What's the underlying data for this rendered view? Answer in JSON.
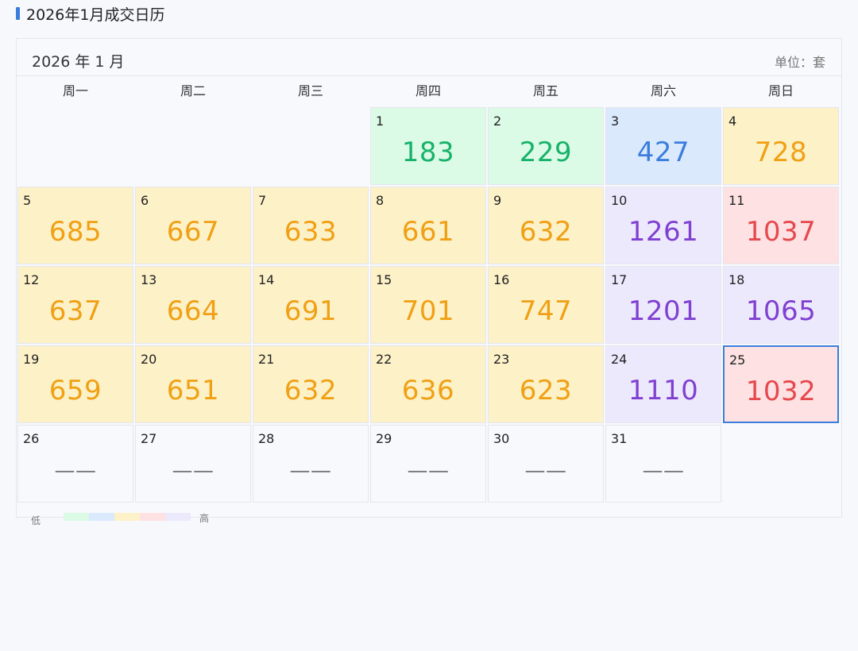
{
  "page_title": "2026年1月成交日历",
  "calendar": {
    "month_label": "2026 年 1 月",
    "unit_label": "单位：套",
    "weekdays": [
      "周一",
      "周二",
      "周三",
      "周四",
      "周五",
      "周六",
      "周日"
    ],
    "first_weekday_index": 3,
    "selected_day": 25,
    "empty_value_text": "——",
    "days": [
      {
        "day": "1",
        "value": "183",
        "level": 0
      },
      {
        "day": "2",
        "value": "229",
        "level": 0
      },
      {
        "day": "3",
        "value": "427",
        "level": 1
      },
      {
        "day": "4",
        "value": "728",
        "level": 2
      },
      {
        "day": "5",
        "value": "685",
        "level": 2
      },
      {
        "day": "6",
        "value": "667",
        "level": 2
      },
      {
        "day": "7",
        "value": "633",
        "level": 2
      },
      {
        "day": "8",
        "value": "661",
        "level": 2
      },
      {
        "day": "9",
        "value": "632",
        "level": 2
      },
      {
        "day": "10",
        "value": "1261",
        "level": 4
      },
      {
        "day": "11",
        "value": "1037",
        "level": 3
      },
      {
        "day": "12",
        "value": "637",
        "level": 2
      },
      {
        "day": "13",
        "value": "664",
        "level": 2
      },
      {
        "day": "14",
        "value": "691",
        "level": 2
      },
      {
        "day": "15",
        "value": "701",
        "level": 2
      },
      {
        "day": "16",
        "value": "747",
        "level": 2
      },
      {
        "day": "17",
        "value": "1201",
        "level": 4
      },
      {
        "day": "18",
        "value": "1065",
        "level": 4
      },
      {
        "day": "19",
        "value": "659",
        "level": 2
      },
      {
        "day": "20",
        "value": "651",
        "level": 2
      },
      {
        "day": "21",
        "value": "632",
        "level": 2
      },
      {
        "day": "22",
        "value": "636",
        "level": 2
      },
      {
        "day": "23",
        "value": "623",
        "level": 2
      },
      {
        "day": "24",
        "value": "1110",
        "level": 4
      },
      {
        "day": "25",
        "value": "1032",
        "level": 3
      },
      {
        "day": "26",
        "value": "",
        "level": -1
      },
      {
        "day": "27",
        "value": "",
        "level": -1
      },
      {
        "day": "28",
        "value": "",
        "level": -1
      },
      {
        "day": "29",
        "value": "",
        "level": -1
      },
      {
        "day": "30",
        "value": "",
        "level": -1
      },
      {
        "day": "31",
        "value": "",
        "level": -1
      }
    ]
  },
  "levels": [
    {
      "bg": "#dcfbe6",
      "fg": "#17b26a"
    },
    {
      "bg": "#dbe9fd",
      "fg": "#3b7ddd"
    },
    {
      "bg": "#fdf1c8",
      "fg": "#f0a014"
    },
    {
      "bg": "#fde1e3",
      "fg": "#e5484d"
    },
    {
      "bg": "#ede9fd",
      "fg": "#8040d0"
    }
  ],
  "legend": {
    "low_label": "低",
    "high_label": "高"
  },
  "colors": {
    "accent": "#3b7ddd",
    "empty_bg": "#f8f9fd"
  }
}
